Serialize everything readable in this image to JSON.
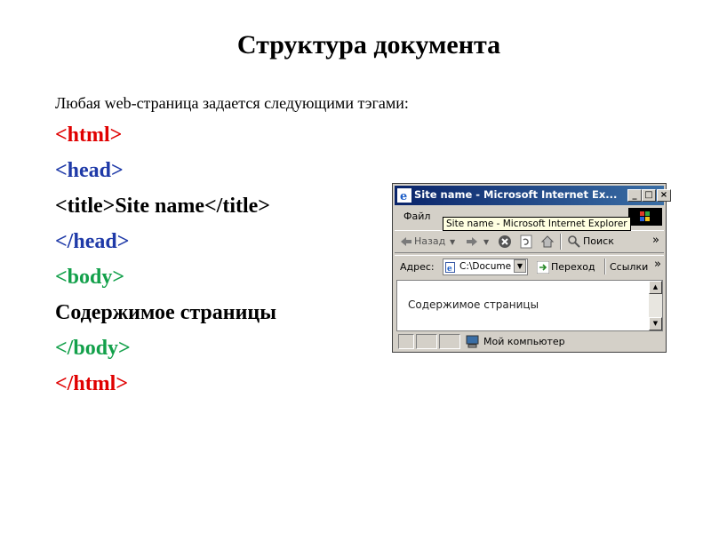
{
  "slide": {
    "title": "Структура документа",
    "intro": "Любая web-страница задается следующими тэгами:",
    "code_lines": [
      "<html>",
      "<head>",
      "<title>Site name</title>",
      "</head>",
      "<body>",
      "Содержимое страницы",
      "</body>",
      "</html>"
    ]
  },
  "browser": {
    "window_title": "Site name - Microsoft Internet Ex...",
    "menu_first": "Файл",
    "tooltip": "Site name - Microsoft Internet Explorer",
    "back_label": "Назад",
    "search_label": "Поиск",
    "address_label": "Адрес:",
    "address_value": "C:\\Docume",
    "go_label": "Переход",
    "links_label": "Ссылки",
    "chevron": "»",
    "page_content": "Содержимое страницы",
    "status_text": "Мой компьютер"
  },
  "colors": {
    "html_tag": "#e00000",
    "head_tag": "#1f3aa8",
    "body_tag": "#12a04a",
    "titlebar": "#0a246a"
  }
}
